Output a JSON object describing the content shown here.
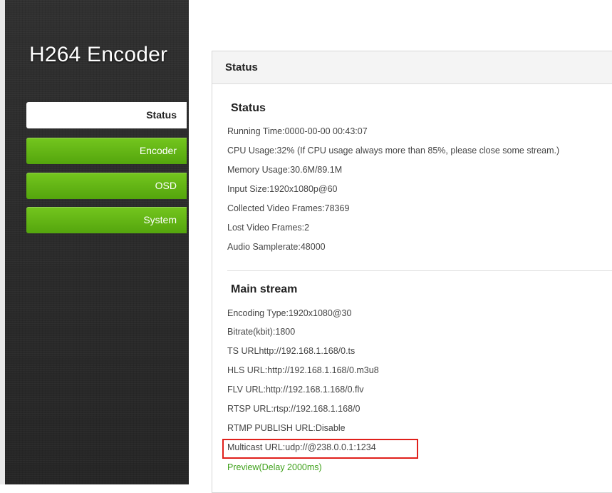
{
  "app": {
    "title": "H264 Encoder"
  },
  "sidebar": {
    "items": [
      {
        "label": "Status",
        "active": true
      },
      {
        "label": "Encoder",
        "active": false
      },
      {
        "label": "OSD",
        "active": false
      },
      {
        "label": "System",
        "active": false
      }
    ]
  },
  "panel": {
    "header": "Status"
  },
  "status_section": {
    "title": "Status",
    "lines": [
      "Running Time:0000-00-00 00:43:07",
      "CPU Usage:32% (If CPU usage always more than 85%, please close some stream.)",
      "Memory Usage:30.6M/89.1M",
      "Input Size:1920x1080p@60",
      "Collected Video Frames:78369",
      "Lost Video Frames:2",
      "Audio Samplerate:48000"
    ]
  },
  "main_stream": {
    "title": "Main stream",
    "lines": [
      "Encoding Type:1920x1080@30",
      "Bitrate(kbit):1800",
      "TS URLhttp://192.168.1.168/0.ts",
      "HLS URL:http://192.168.1.168/0.m3u8",
      "FLV URL:http://192.168.1.168/0.flv",
      "RTSP URL:rtsp://192.168.1.168/0",
      "RTMP PUBLISH URL:Disable",
      "Multicast URL:udp://@238.0.0.1:1234"
    ],
    "preview_label": "Preview(Delay 2000ms)"
  },
  "colors": {
    "nav_green": "#5cb012",
    "highlight_red": "#e0201b",
    "preview_green": "#3ea11a"
  }
}
